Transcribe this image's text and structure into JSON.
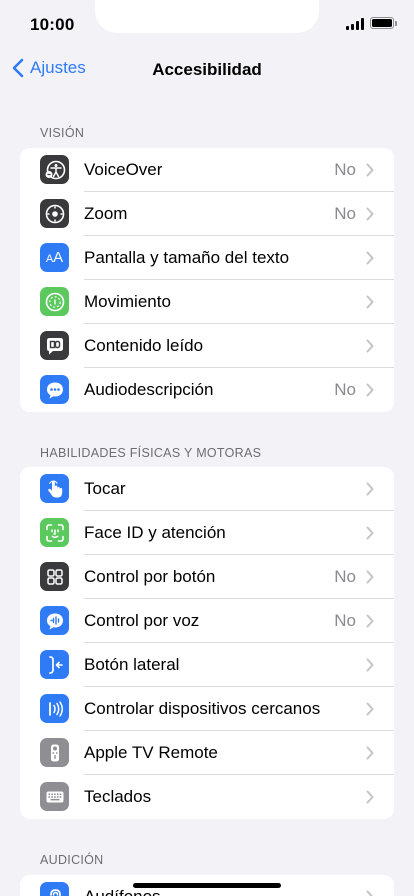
{
  "status_bar": {
    "time": "10:00"
  },
  "nav": {
    "back_label": "Ajustes",
    "title": "Accesibilidad"
  },
  "colors": {
    "accent": "#2f7bf6",
    "background": "#f2f2f7"
  },
  "sections": [
    {
      "header": "VISIÓN",
      "items": [
        {
          "label": "VoiceOver",
          "value": "No",
          "icon": "voiceover-icon",
          "icon_color": "#1c1c1e"
        },
        {
          "label": "Zoom",
          "value": "No",
          "icon": "zoom-icon",
          "icon_color": "#1c1c1e"
        },
        {
          "label": "Pantalla y tamaño del texto",
          "value": "",
          "icon": "text-size-icon",
          "icon_color": "#2f7bf6"
        },
        {
          "label": "Movimiento",
          "value": "",
          "icon": "motion-icon",
          "icon_color": "#5cc95f"
        },
        {
          "label": "Contenido leído",
          "value": "",
          "icon": "spoken-content-icon",
          "icon_color": "#1c1c1e"
        },
        {
          "label": "Audiodescripción",
          "value": "No",
          "icon": "audio-description-icon",
          "icon_color": "#2f7bf6"
        }
      ]
    },
    {
      "header": "HABILIDADES FÍSICAS Y MOTORAS",
      "items": [
        {
          "label": "Tocar",
          "value": "",
          "icon": "touch-icon",
          "icon_color": "#2f7bf6"
        },
        {
          "label": "Face ID y atención",
          "value": "",
          "icon": "face-id-icon",
          "icon_color": "#5cc95f"
        },
        {
          "label": "Control por botón",
          "value": "No",
          "icon": "switch-control-icon",
          "icon_color": "#1c1c1e"
        },
        {
          "label": "Control por voz",
          "value": "No",
          "icon": "voice-control-icon",
          "icon_color": "#2f7bf6"
        },
        {
          "label": "Botón lateral",
          "value": "",
          "icon": "side-button-icon",
          "icon_color": "#2f7bf6"
        },
        {
          "label": "Controlar dispositivos cercanos",
          "value": "",
          "icon": "nearby-devices-icon",
          "icon_color": "#2f7bf6"
        },
        {
          "label": "Apple TV Remote",
          "value": "",
          "icon": "tv-remote-icon",
          "icon_color": "#8e8e93"
        },
        {
          "label": "Teclados",
          "value": "",
          "icon": "keyboard-icon",
          "icon_color": "#8e8e93"
        }
      ]
    },
    {
      "header": "AUDICIÓN",
      "items": [
        {
          "label": "Audífonos",
          "value": "",
          "icon": "hearing-devices-icon",
          "icon_color": "#2f7bf6"
        }
      ]
    }
  ]
}
